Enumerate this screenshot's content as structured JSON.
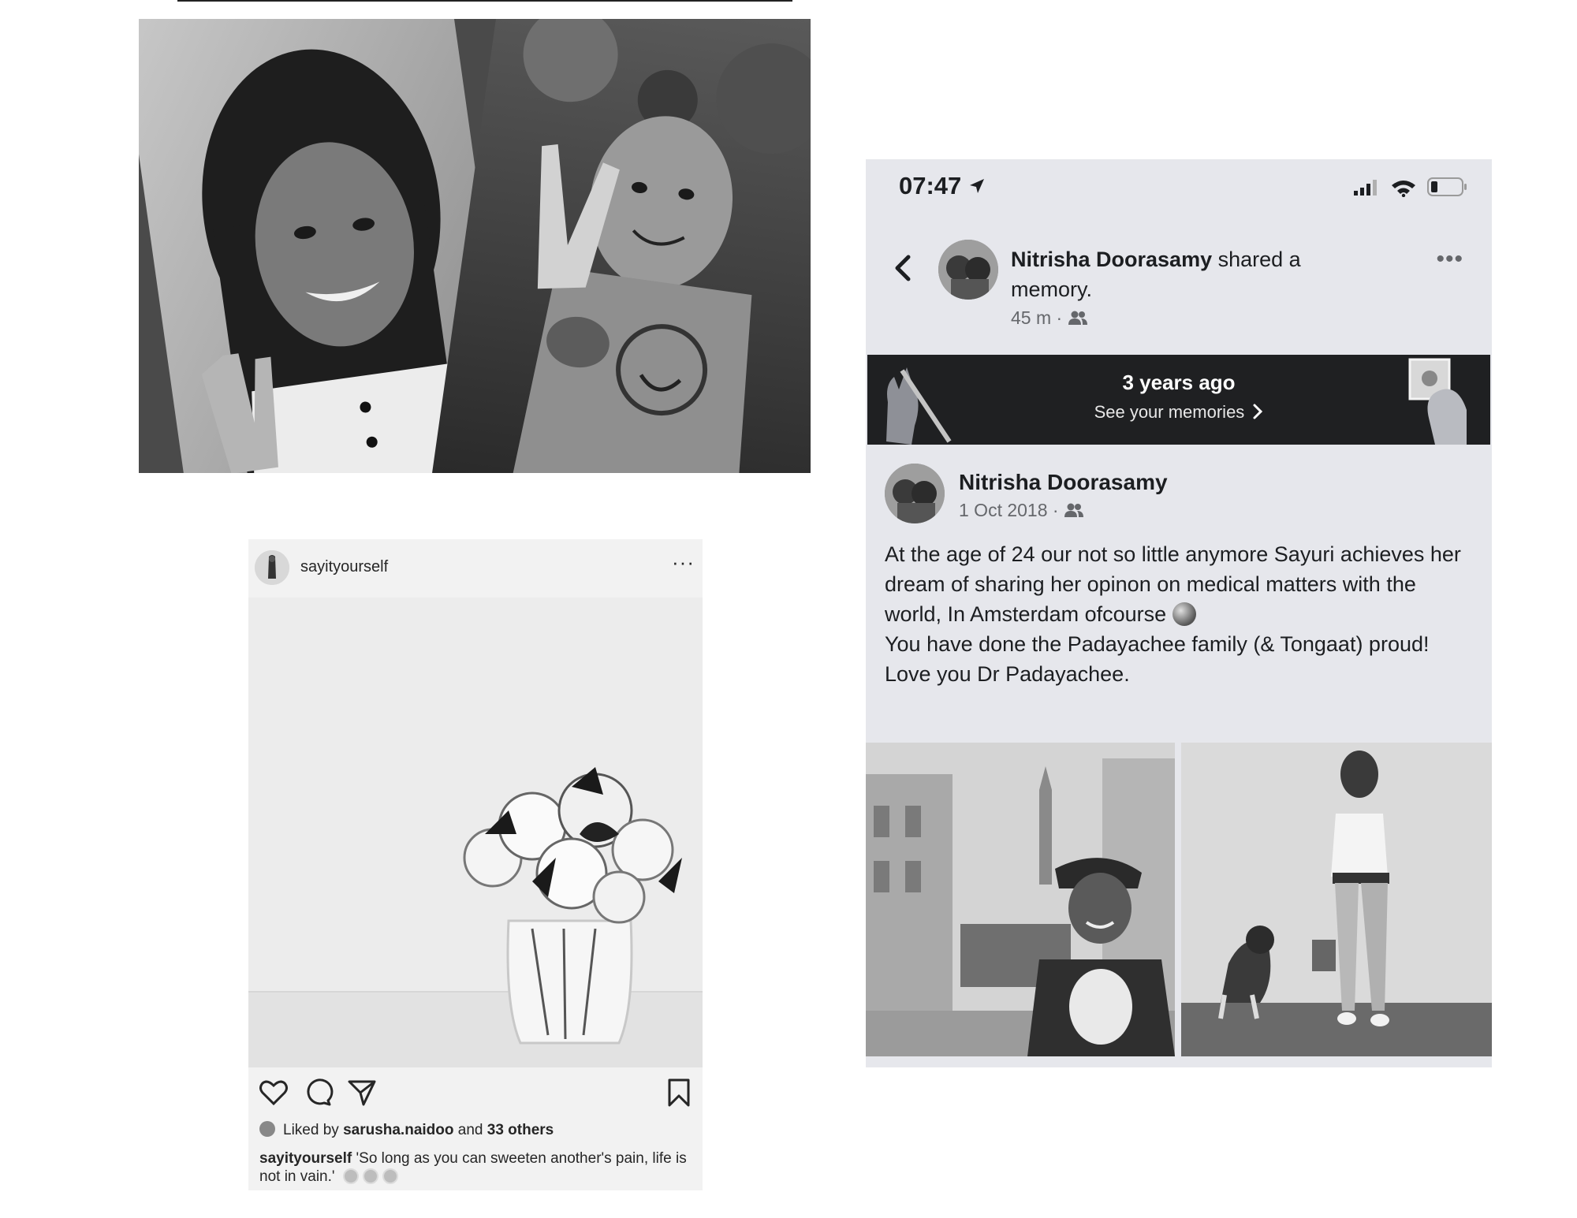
{
  "collage": {
    "alt_left": "Black and white photo of a smiling young woman making a peace sign",
    "alt_right": "Black and white photo of a young girl with hair buns making a peace sign"
  },
  "instagram": {
    "username": "sayityourself",
    "more_label": "···",
    "likes_prefix": "Liked by",
    "likes_user": "sarusha.naidoo",
    "likes_and": "and",
    "likes_others": "33 others",
    "caption_user": "sayityourself",
    "caption_text": "'So long as you can sweeten another's pain, life is not in vain.'",
    "icons": [
      "heart-icon",
      "comment-icon",
      "share-icon",
      "bookmark-icon"
    ]
  },
  "facebook": {
    "status_bar": {
      "time": "07:47",
      "icons": [
        "location-arrow-icon",
        "signal-icon",
        "wifi-icon",
        "battery-icon"
      ]
    },
    "header": {
      "author": "Nitrisha Doorasamy",
      "action": "shared a memory.",
      "time_ago": "45 m",
      "separator": "·",
      "audience_icon": "friends-icon",
      "more_label": "•••"
    },
    "memory_banner": {
      "title": "3 years ago",
      "link": "See your memories",
      "link_chevron": "›"
    },
    "post": {
      "author": "Nitrisha Doorasamy",
      "date": "1 Oct 2018",
      "separator": "·",
      "lines": [
        "At the age of 24 our not so little anymore Sayuri achieves her dream of sharing her opinon on medical matters with the world, In Amsterdam ofcourse",
        "You have done the Padayachee family (& Tongaat) proud!",
        "Love you Dr Padayachee."
      ]
    }
  },
  "colors": {
    "fb_background": "#e6e7ec",
    "banner": "#1f2022",
    "text_primary": "#1c1e21",
    "text_secondary": "#65676b"
  }
}
